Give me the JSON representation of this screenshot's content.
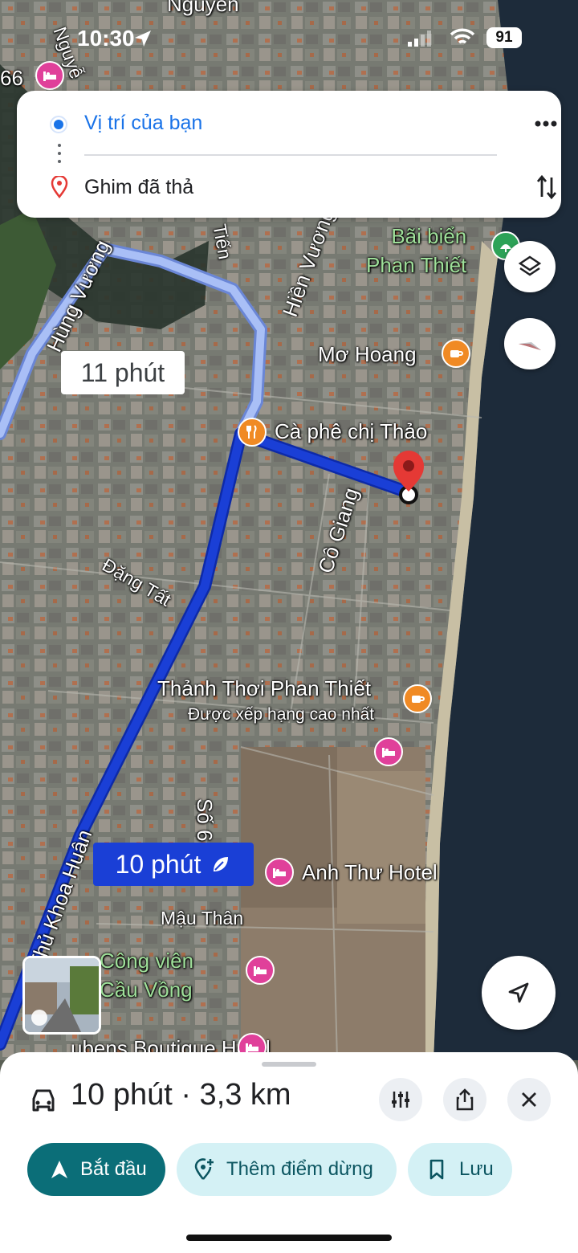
{
  "status_bar": {
    "time": "10:30",
    "battery": "91"
  },
  "route_card": {
    "origin": "Vị trí của bạn",
    "destination": "Ghim đã thả"
  },
  "map": {
    "streets": {
      "hung_vuong": "Hùng Vương",
      "hien_vuong": "Hiền Vương",
      "tien": "Tiến",
      "dang_tat": "Đặng Tất",
      "co_giang": "Cô Giang",
      "so_6": "Số 6",
      "thu_khoa_huan": "Thủ Khoa Huân",
      "mau_than": "Mậu Thân",
      "nguyen_top": "Nguyễn",
      "nguyen_left": "Nguyễ",
      "number_66": "66"
    },
    "places": {
      "bai_bien": "Bãi biển\nPhan Thiết",
      "mo_hoang": "Mơ Hoang",
      "ca_phe": "Cà phê chị Thảo",
      "thanh_thoi": "Thảnh Thơi Phan Thiết",
      "thanh_thoi_sub": "Được xếp hạng cao nhất",
      "anh_thu": "Anh Thư Hotel",
      "cong_vien": "Công viên\nCầu Vồng",
      "boutique": "ubens Boutique Hotel"
    },
    "route_times": {
      "alt": "11 phút",
      "main": "10 phút"
    }
  },
  "bottom_sheet": {
    "summary": "10 phút · 3,3 km",
    "start_label": "Bắt đầu",
    "add_stop_label": "Thêm điểm dừng",
    "save_label": "Lưu"
  },
  "colors": {
    "route_main": "#1a3fd6",
    "route_alt": "#a9bff6",
    "start_button": "#0b6e78",
    "secondary_button": "#d4f1f5",
    "pin": "#e53935"
  },
  "icons": [
    "car-icon",
    "adjust-icon",
    "share-icon",
    "close-icon",
    "navigation-icon",
    "pin-icon",
    "bookmark-icon",
    "layers-icon",
    "compass-icon",
    "locate-icon",
    "more-icon",
    "swap-icon"
  ]
}
